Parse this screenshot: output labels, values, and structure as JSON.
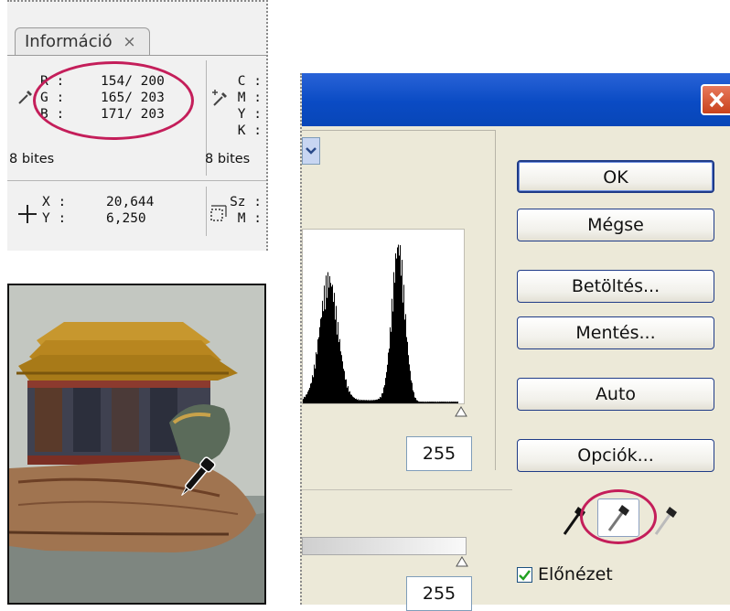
{
  "info_panel": {
    "tab_label": "Információ",
    "tab_close": "×",
    "rgb_labels": [
      "R :",
      "G :",
      "B :"
    ],
    "rgb_values": [
      "154/ 200",
      "165/ 203",
      "171/ 203"
    ],
    "cmyk_labels": [
      "C :",
      "M :",
      "Y :",
      "K :"
    ],
    "bit_depth_left": "8 bites",
    "bit_depth_right": "8 bites",
    "xy_labels": [
      "X :",
      "Y :"
    ],
    "xy_values": [
      "20,644",
      "6,250"
    ],
    "size_labels": [
      "Sz :",
      "M :"
    ]
  },
  "dialog": {
    "buttons": {
      "ok": "OK",
      "cancel": "Mégse",
      "load": "Betöltés...",
      "save": "Mentés...",
      "auto": "Auto",
      "options": "Opciók..."
    },
    "output_white": "255",
    "bottom_white": "255",
    "preview_label": "Előnézet",
    "preview_checked": true
  },
  "colors": {
    "highlight": "#c41e5a",
    "titlebar": "#0a4bc4",
    "dialog_bg": "#ece9d8"
  },
  "icons": {
    "info_eyedropper": "eyedropper-icon",
    "info_eyedropper_plus": "eyedropper-plus-icon",
    "crosshair": "crosshair-icon",
    "selection_size": "selection-size-icon",
    "black_point": "black-eyedropper-icon",
    "gray_point": "gray-eyedropper-icon",
    "white_point": "white-eyedropper-icon",
    "cursor": "eyedropper-cursor-icon"
  }
}
